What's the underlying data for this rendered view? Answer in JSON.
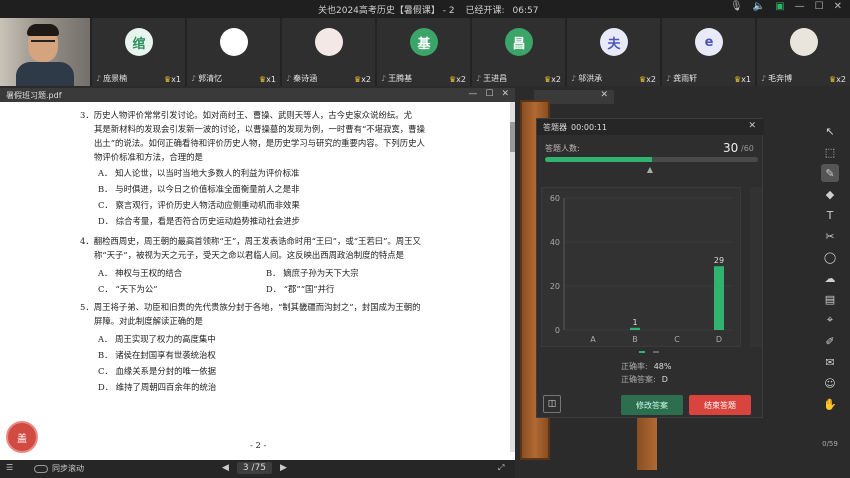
{
  "window": {
    "title": "关也2024高考历史【暑假课】 - 2",
    "elapsed_label": "已经开课:",
    "elapsed": "06:57"
  },
  "participants": [
    {
      "initial": "绾",
      "name": "庞景楠",
      "cups": "x1",
      "bg": "#e8f5ee",
      "fg": "#2f8f5e"
    },
    {
      "initial": "",
      "name": "郭清忆",
      "cups": "x1",
      "bg": "#ffffff",
      "fg": "#333333",
      "avatar": "anime"
    },
    {
      "initial": "",
      "name": "秦诗涵",
      "cups": "x2",
      "bg": "#f3e8e6",
      "fg": "#333333",
      "avatar": "photo"
    },
    {
      "initial": "基",
      "name": "王腾基",
      "cups": "x2",
      "bg": "#3aa469",
      "fg": "#ffffff"
    },
    {
      "initial": "昌",
      "name": "王进昌",
      "cups": "x2",
      "bg": "#3aa469",
      "fg": "#ffffff"
    },
    {
      "initial": "夫",
      "name": "邬洪承",
      "cups": "x2",
      "bg": "#e8eaf8",
      "fg": "#4b56b8"
    },
    {
      "initial": "e",
      "name": "龚雨轩",
      "cups": "x1",
      "bg": "#e8eaf8",
      "fg": "#4b56b8"
    },
    {
      "initial": "",
      "name": "毛奔博",
      "cups": "x2",
      "bg": "#e9e4dc",
      "fg": "#333333",
      "avatar": "photo"
    }
  ],
  "pdf": {
    "filename": "暑假班习题.pdf",
    "lines": [
      "3．历史人物评价常常引发讨论。如对商纣王、曹操、武则天等人，古今史家众说纷纭。尤",
      "其是新材料的发现会引发新一波的讨论，以曹操墓的发现为例，一时曹有“不堪寂寞，曹操",
      "出土”的说法。如何正确看待和评价历史人物，是历史学习与研究的重要内容。下列历史人",
      "物评价标准和方法，合理的是",
      "A． 知人论世，以当时当地大多数人的利益为评价标准",
      "B． 与时俱进，以今日之价值标准全面衡量前人之是非",
      "C． 察言观行，评价历史人物活动应侧重动机而非效果",
      "D． 综合考量，看是否符合历史运动趋势推动社会进步",
      "4．翻检西周史，周王朝的最高首领称“王”，周王发表诰命时用“王曰”，或“王若曰”。周王又",
      "称“天子”，被视为天之元子，受天之命以君临人间。这反映出西周政治制度的特点是",
      "A． 神权与王权的结合",
      "B． 嫡庶子孙为天下大宗",
      "C． “天下为公”",
      "D． “郡”“国”并行",
      "5．周王将子弟、功臣和旧贵的先代贵族分封于各地，“制其畿疆而沟封之”，封国成为王朝的",
      "屏障。对此制度解读正确的是",
      "A． 周王实现了权力的高度集中",
      "B． 诸侯在封国享有世袭统治权",
      "C． 血缘关系是分封的唯一依据",
      "D． 维持了周朝四百余年的统治"
    ],
    "page_num": "- 2 -",
    "sync_label": "同步滚动",
    "current_page": "3",
    "total_pages": "/75",
    "stamp_text": "盖"
  },
  "quiz": {
    "title": "答题器",
    "timer": "00:00:11",
    "answered_label": "答题人数:",
    "answered": "30",
    "total": "/60",
    "progress": 0.5,
    "accuracy_label": "正确率:",
    "accuracy": "48%",
    "correct_label": "正确答案:",
    "correct": "D",
    "modify_label": "修改答案",
    "end_label": "结束答题"
  },
  "chart_data": {
    "type": "bar",
    "categories": [
      "A",
      "B",
      "C",
      "D"
    ],
    "values": [
      0,
      1,
      0,
      29
    ],
    "data_labels": [
      "",
      "1",
      "",
      "29"
    ],
    "yticks": [
      "0",
      "20",
      "40",
      "60"
    ],
    "ylim": [
      0,
      60
    ],
    "colors": {
      "bar": "#2fb36e",
      "correct": "#2fb36e"
    }
  },
  "tools": {
    "count": "0/59",
    "icons": [
      "cursor-icon",
      "select-icon",
      "pen-icon",
      "eraser-icon",
      "text-icon",
      "scissors-icon",
      "shape-icon",
      "cloud-icon",
      "layers-icon",
      "ruler-icon",
      "edit-icon",
      "chat-icon",
      "users-icon",
      "hand-icon"
    ]
  }
}
